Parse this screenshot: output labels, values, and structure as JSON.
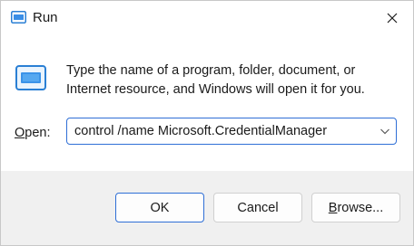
{
  "window": {
    "title": "Run",
    "icon": "run-app-icon",
    "close_icon": "close-icon"
  },
  "content": {
    "description": "Type the name of a program, folder, document, or Internet resource, and Windows will open it for you.",
    "open_label_accel": "O",
    "open_label_rest": "pen:",
    "open_value": "control /name Microsoft.CredentialManager"
  },
  "buttons": {
    "ok": "OK",
    "cancel": "Cancel",
    "browse_accel": "B",
    "browse_rest": "rowse..."
  },
  "colors": {
    "accent": "#2f6fd6",
    "footer_bg": "#f0f0f0"
  }
}
